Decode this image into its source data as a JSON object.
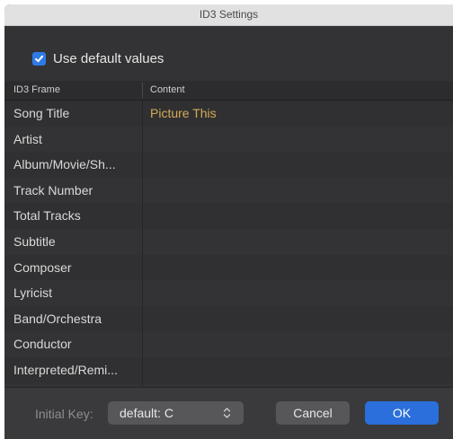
{
  "window": {
    "title": "ID3 Settings"
  },
  "options": {
    "use_default_label": "Use default values",
    "use_default_checked": true
  },
  "table": {
    "columns": [
      "ID3 Frame",
      "Content"
    ],
    "rows": [
      {
        "frame": "Song Title",
        "content": "Picture This"
      },
      {
        "frame": "Artist",
        "content": ""
      },
      {
        "frame": "Album/Movie/Sh...",
        "content": ""
      },
      {
        "frame": "Track Number",
        "content": ""
      },
      {
        "frame": "Total Tracks",
        "content": ""
      },
      {
        "frame": "Subtitle",
        "content": ""
      },
      {
        "frame": "Composer",
        "content": ""
      },
      {
        "frame": "Lyricist",
        "content": ""
      },
      {
        "frame": "Band/Orchestra",
        "content": ""
      },
      {
        "frame": "Conductor",
        "content": ""
      },
      {
        "frame": "Interpreted/Remi...",
        "content": ""
      }
    ]
  },
  "footer": {
    "initial_key_label": "Initial Key:",
    "initial_key_value": "default: C",
    "cancel_label": "Cancel",
    "ok_label": "OK"
  },
  "colors": {
    "accent": "#2a6fdb",
    "content_text": "#d6aa55",
    "background": "#333335"
  },
  "icons": {
    "checkbox": "checkmark-icon",
    "select": "up-down-chevron-icon"
  }
}
